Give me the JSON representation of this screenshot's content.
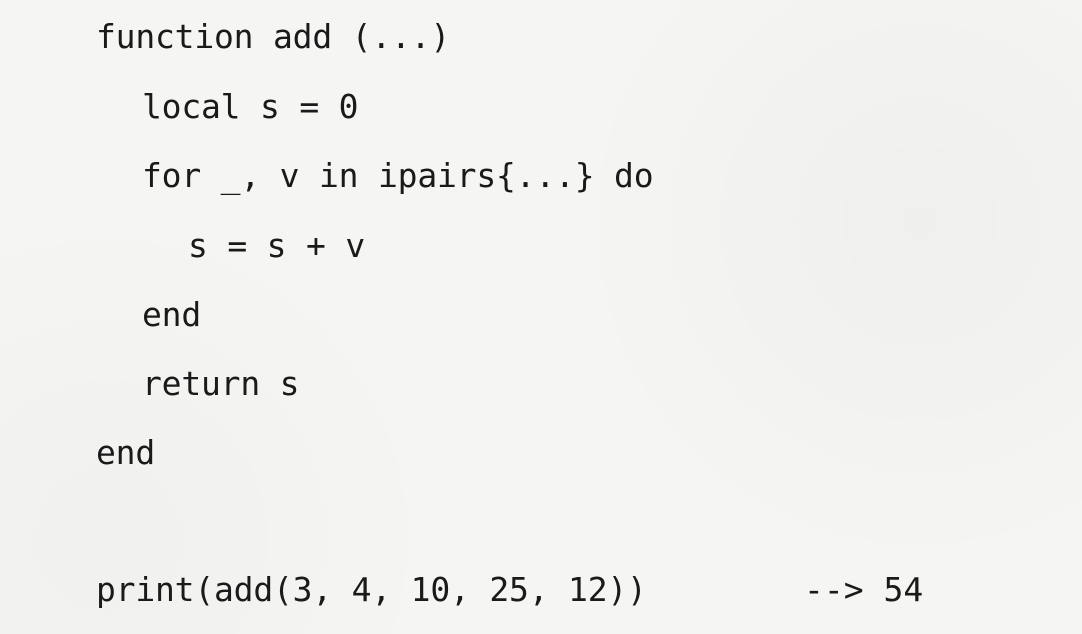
{
  "code": {
    "lines": [
      "function add (...)",
      "local s = 0",
      "for _, v in ipairs{...} do",
      "s = s + v",
      "end",
      "return s",
      "end",
      "print(add(3, 4, 10, 25, 12))"
    ],
    "result_comment": "--> 54"
  }
}
